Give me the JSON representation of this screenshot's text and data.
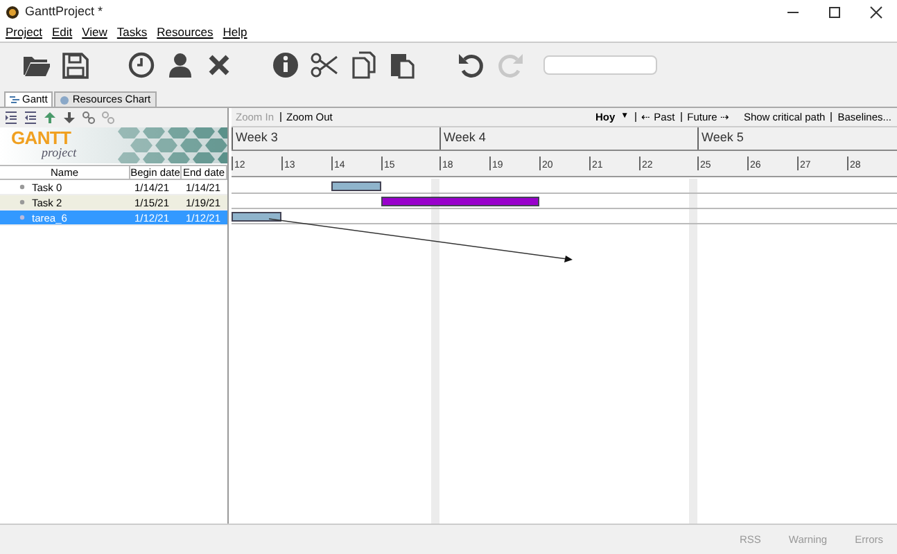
{
  "window": {
    "title": "GanttProject *"
  },
  "menu": [
    "Project",
    "Edit",
    "View",
    "Tasks",
    "Resources",
    "Help"
  ],
  "toolbar": {
    "buttons": [
      {
        "kind": "open",
        "disabled": false
      },
      {
        "kind": "save",
        "disabled": false
      },
      {
        "kind": "clock",
        "disabled": false
      },
      {
        "kind": "person",
        "disabled": false
      },
      {
        "kind": "delete",
        "disabled": false
      },
      {
        "kind": "info",
        "disabled": false
      },
      {
        "kind": "cut",
        "disabled": false
      },
      {
        "kind": "copy",
        "disabled": false
      },
      {
        "kind": "paste",
        "disabled": false
      },
      {
        "kind": "undo",
        "disabled": false
      },
      {
        "kind": "redo",
        "disabled": true
      }
    ]
  },
  "tabs": [
    {
      "label": "Gantt",
      "selected": true
    },
    {
      "label": "Resources Chart",
      "selected": false
    }
  ],
  "logo": {
    "word": "GANTT",
    "subtitle": "project"
  },
  "table": {
    "columns": [
      "Name",
      "Begin date",
      "End date"
    ],
    "rows": [
      {
        "name": "Task 0",
        "begin": "1/14/21",
        "end": "1/14/21",
        "selected": false,
        "color": "#8fb4cc"
      },
      {
        "name": "Task 2",
        "begin": "1/15/21",
        "end": "1/19/21",
        "selected": false,
        "color": "#9900cc"
      },
      {
        "name": "tarea_6",
        "begin": "1/12/21",
        "end": "1/12/21",
        "selected": true,
        "color": "#8fb4cc"
      }
    ]
  },
  "chart_toolbar": {
    "zoom_in": {
      "label": "Zoom In",
      "disabled": true
    },
    "zoom_out": {
      "label": "Zoom Out",
      "disabled": false
    },
    "today": "Hoy",
    "caret": "▼",
    "past": "⇠ Past",
    "future": "Future ⇢",
    "critical_path": "Show critical path",
    "baselines": "Baselines..."
  },
  "weeks": [
    {
      "label": "Week 3",
      "days": [
        "12",
        "13",
        "14",
        "15"
      ]
    },
    {
      "label": "Week 4",
      "days": [
        "18",
        "19",
        "20",
        "21",
        "22"
      ]
    },
    {
      "label": "Week 5",
      "days": [
        "25",
        "26",
        "27",
        "28"
      ]
    }
  ],
  "status_bar": [
    "RSS",
    "Warning",
    "Errors"
  ]
}
